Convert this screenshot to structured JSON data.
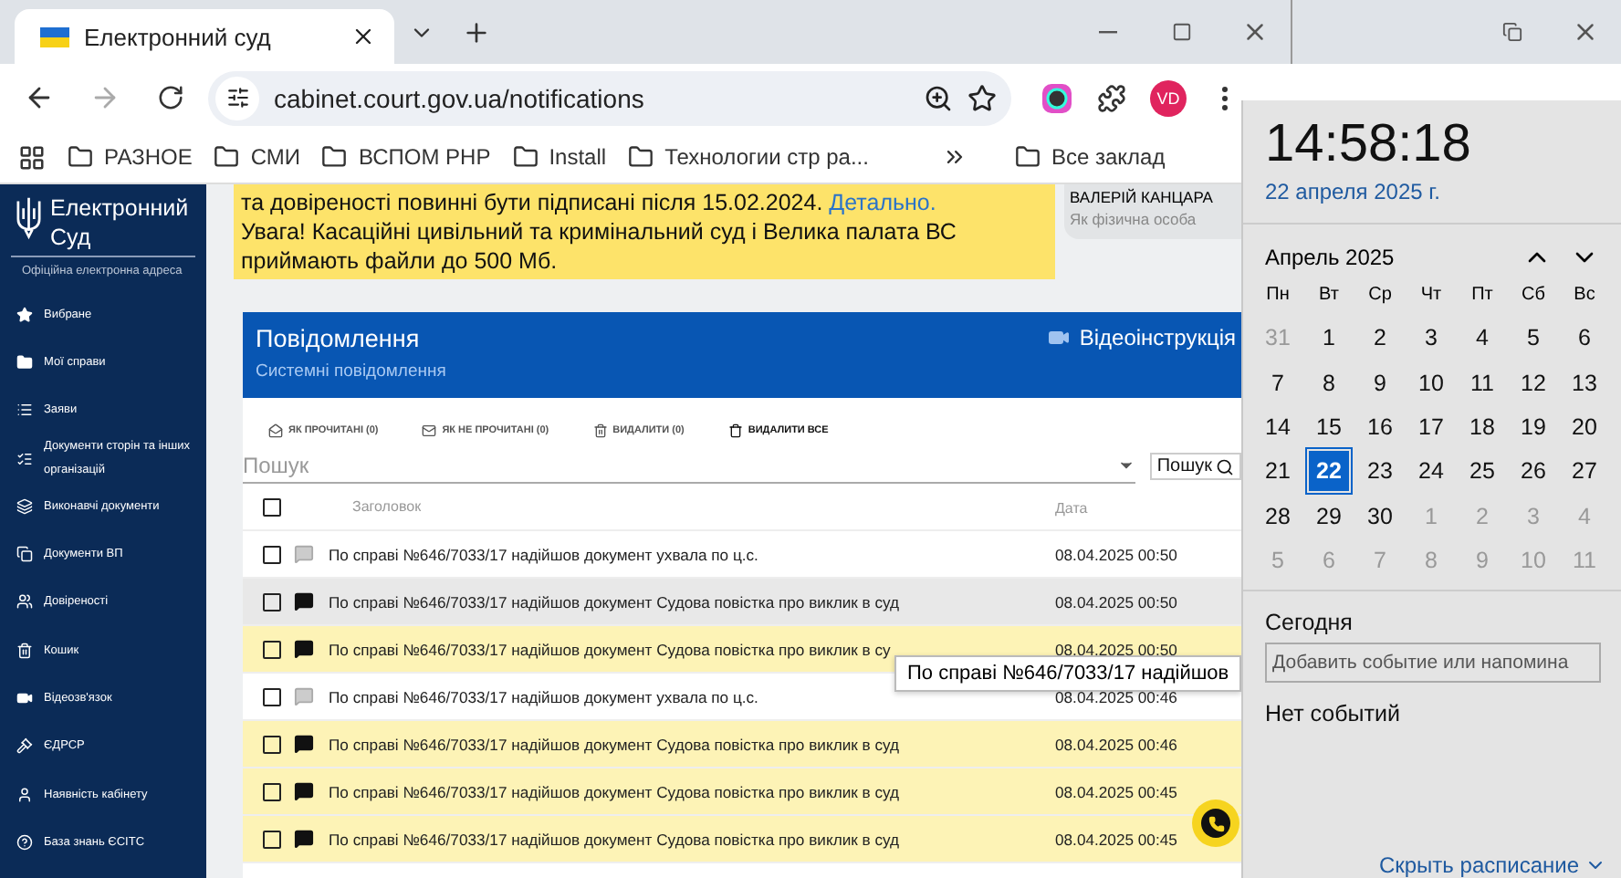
{
  "browser": {
    "tab_title": "Електронний суд",
    "address": "cabinet.court.gov.ua/notifications",
    "profile": "VD",
    "bookmarks": [
      "РАЗНОЕ",
      "СМИ",
      "ВСПОМ PHP",
      "Install",
      "Технологии стр ра..."
    ],
    "more_bookmarks": "Все заклад"
  },
  "sidebar": {
    "title": "Електронний Суд",
    "subtitle": "Офіційна електронна адреса",
    "items": [
      "Вибране",
      "Мої справи",
      "Заяви",
      "Документи сторін та інших організацій",
      "Виконавчі документи",
      "Документи ВП",
      "Довіреності",
      "Кошик",
      "Відеозв'язок",
      "ЄДРСР",
      "Наявність кабінету",
      "База знань ЄСІТС"
    ]
  },
  "banner": {
    "text": "та довіреності повинні бути підписані після 15.02.2024.",
    "link": "Детально.",
    "warning": "Увага! Касаційні цивільний та кримінальний суд і Велика палата ВС приймають файли до 500 Мб."
  },
  "user": {
    "name": "ВАЛЕРІЙ КАНЦАРА",
    "role": "Як фізична особа"
  },
  "panel": {
    "title": "Повідомлення",
    "subtitle": "Системні повідомлення",
    "video_label": "Відеоінструкція",
    "actions": [
      "ЯК ПРОЧИТАНІ (0)",
      "ЯК НЕ ПРОЧИТАНІ (0)",
      "ВИДАЛИТИ (0)",
      "ВИДАЛИТИ ВСЕ"
    ],
    "search_placeholder": "Пошук",
    "search_button": "Пошук",
    "columns": [
      "Заголовок",
      "Дата"
    ],
    "select_all_checked": false,
    "rows": [
      {
        "title": "По справі №646/7033/17 надійшов документ ухвала по ц.с.",
        "date": "08.04.2025 00:50",
        "read": true,
        "hovered": false,
        "checked": false
      },
      {
        "title": "По справі №646/7033/17 надійшов документ Судова повістка про виклик в суд",
        "date": "08.04.2025 00:50",
        "read": false,
        "hovered": true,
        "checked": false
      },
      {
        "title": "По справі №646/7033/17 надійшов документ Судова повістка про виклик в су",
        "date": "08.04.2025 00:50",
        "read": false,
        "hovered": false,
        "checked": false
      },
      {
        "title": "По справі №646/7033/17 надійшов документ ухвала по ц.с.",
        "date": "08.04.2025 00:46",
        "read": true,
        "hovered": false,
        "checked": false
      },
      {
        "title": "По справі №646/7033/17 надійшов документ Судова повістка про виклик в суд",
        "date": "08.04.2025 00:46",
        "read": false,
        "hovered": false,
        "checked": false
      },
      {
        "title": "По справі №646/7033/17 надійшов документ Судова повістка про виклик в суд",
        "date": "08.04.2025 00:45",
        "read": false,
        "hovered": false,
        "checked": false
      },
      {
        "title": "По справі №646/7033/17 надійшов документ Судова повістка про виклик в суд",
        "date": "08.04.2025 00:45",
        "read": false,
        "hovered": false,
        "checked": false
      }
    ],
    "tooltip": "По справі №646/7033/17 надійшов"
  },
  "calendar": {
    "time": "14:58:18",
    "date": "22 апреля 2025 г.",
    "month": "Апрель 2025",
    "weekdays": [
      "Пн",
      "Вт",
      "Ср",
      "Чт",
      "Пт",
      "Сб",
      "Вс"
    ],
    "days": [
      {
        "day": "31",
        "muted": true,
        "selected": false
      },
      {
        "day": "1",
        "muted": false,
        "selected": false
      },
      {
        "day": "2",
        "muted": false,
        "selected": false
      },
      {
        "day": "3",
        "muted": false,
        "selected": false
      },
      {
        "day": "4",
        "muted": false,
        "selected": false
      },
      {
        "day": "5",
        "muted": false,
        "selected": false
      },
      {
        "day": "6",
        "muted": false,
        "selected": false
      },
      {
        "day": "7",
        "muted": false,
        "selected": false
      },
      {
        "day": "8",
        "muted": false,
        "selected": false
      },
      {
        "day": "9",
        "muted": false,
        "selected": false
      },
      {
        "day": "10",
        "muted": false,
        "selected": false
      },
      {
        "day": "11",
        "muted": false,
        "selected": false
      },
      {
        "day": "12",
        "muted": false,
        "selected": false
      },
      {
        "day": "13",
        "muted": false,
        "selected": false
      },
      {
        "day": "14",
        "muted": false,
        "selected": false
      },
      {
        "day": "15",
        "muted": false,
        "selected": false
      },
      {
        "day": "16",
        "muted": false,
        "selected": false
      },
      {
        "day": "17",
        "muted": false,
        "selected": false
      },
      {
        "day": "18",
        "muted": false,
        "selected": false
      },
      {
        "day": "19",
        "muted": false,
        "selected": false
      },
      {
        "day": "20",
        "muted": false,
        "selected": false
      },
      {
        "day": "21",
        "muted": false,
        "selected": false
      },
      {
        "day": "22",
        "muted": false,
        "selected": true
      },
      {
        "day": "23",
        "muted": false,
        "selected": false
      },
      {
        "day": "24",
        "muted": false,
        "selected": false
      },
      {
        "day": "25",
        "muted": false,
        "selected": false
      },
      {
        "day": "26",
        "muted": false,
        "selected": false
      },
      {
        "day": "27",
        "muted": false,
        "selected": false
      },
      {
        "day": "28",
        "muted": false,
        "selected": false
      },
      {
        "day": "29",
        "muted": false,
        "selected": false
      },
      {
        "day": "30",
        "muted": false,
        "selected": false
      },
      {
        "day": "1",
        "muted": true,
        "selected": false
      },
      {
        "day": "2",
        "muted": true,
        "selected": false
      },
      {
        "day": "3",
        "muted": true,
        "selected": false
      },
      {
        "day": "4",
        "muted": true,
        "selected": false
      },
      {
        "day": "5",
        "muted": true,
        "selected": false
      },
      {
        "day": "6",
        "muted": true,
        "selected": false
      },
      {
        "day": "7",
        "muted": true,
        "selected": false
      },
      {
        "day": "8",
        "muted": true,
        "selected": false
      },
      {
        "day": "9",
        "muted": true,
        "selected": false
      },
      {
        "day": "10",
        "muted": true,
        "selected": false
      },
      {
        "day": "11",
        "muted": true,
        "selected": false
      }
    ],
    "today_label": "Сегодня",
    "event_placeholder": "Добавить событие или напомина",
    "no_events": "Нет событий",
    "hide_link": "Скрыть расписание"
  }
}
